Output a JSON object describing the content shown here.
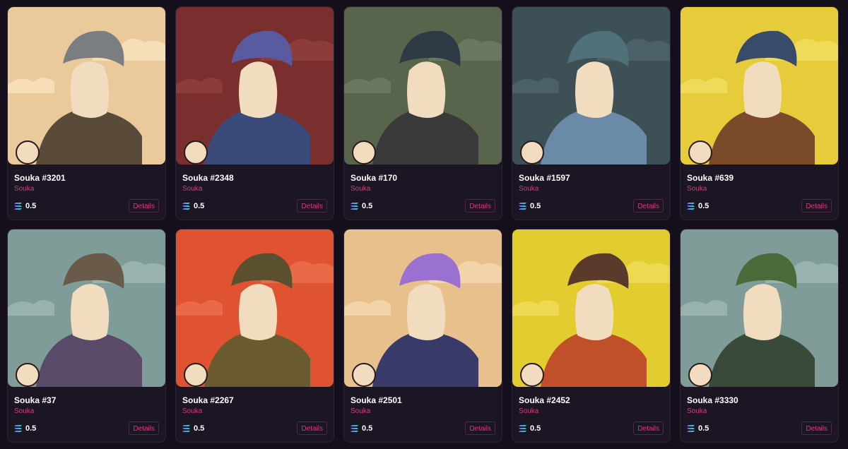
{
  "nfts": [
    {
      "title": "Souka #3201",
      "collection": "Souka",
      "price": "0.5",
      "details_label": "Details",
      "bg": "#eac99a",
      "cloud": "#f5deb8",
      "cap": "#7a7e80",
      "skin": "#f2dcc0",
      "cloth": "#5a4a3a"
    },
    {
      "title": "Souka #2348",
      "collection": "Souka",
      "price": "0.5",
      "details_label": "Details",
      "bg": "#7a2e2e",
      "cloud": "#8e3c3a",
      "cap": "#5a5aa0",
      "skin": "#f2dcc0",
      "cloth": "#3a4a7a"
    },
    {
      "title": "Souka #170",
      "collection": "Souka",
      "price": "0.5",
      "details_label": "Details",
      "bg": "#58654c",
      "cloud": "#6a7860",
      "cap": "#2e3a44",
      "skin": "#f2dcc0",
      "cloth": "#3a3a3a"
    },
    {
      "title": "Souka #1597",
      "collection": "Souka",
      "price": "0.5",
      "details_label": "Details",
      "bg": "#3d5056",
      "cloud": "#4c6068",
      "cap": "#50707a",
      "skin": "#f2dcc0",
      "cloth": "#6a8aa8"
    },
    {
      "title": "Souka #639",
      "collection": "Souka",
      "price": "0.5",
      "details_label": "Details",
      "bg": "#e6cc3a",
      "cloud": "#f0da5a",
      "cap": "#3a4a6a",
      "skin": "#f2dcc0",
      "cloth": "#7a4a2a"
    },
    {
      "title": "Souka #37",
      "collection": "Souka",
      "price": "0.5",
      "details_label": "Details",
      "bg": "#7f9c98",
      "cloud": "#98b2ae",
      "cap": "#6a5a4a",
      "skin": "#f2dcc0",
      "cloth": "#5a4a6a"
    },
    {
      "title": "Souka #2267",
      "collection": "Souka",
      "price": "0.5",
      "details_label": "Details",
      "bg": "#df5232",
      "cloud": "#ea6a48",
      "cap": "#5a5030",
      "skin": "#f2dcc0",
      "cloth": "#6a5a30"
    },
    {
      "title": "Souka #2501",
      "collection": "Souka",
      "price": "0.5",
      "details_label": "Details",
      "bg": "#e8c08c",
      "cloud": "#f2d4aa",
      "cap": "#9a70d0",
      "skin": "#f2dcc0",
      "cloth": "#3a3a6a"
    },
    {
      "title": "Souka #2452",
      "collection": "Souka",
      "price": "0.5",
      "details_label": "Details",
      "bg": "#e2cc30",
      "cloud": "#eeda50",
      "cap": "#5a3a2a",
      "skin": "#f2dcc0",
      "cloth": "#c0502a"
    },
    {
      "title": "Souka #3330",
      "collection": "Souka",
      "price": "0.5",
      "details_label": "Details",
      "bg": "#7f9c98",
      "cloud": "#98b2ae",
      "cap": "#4a6a3a",
      "skin": "#f2dcc0",
      "cloth": "#3a4a3a"
    }
  ]
}
